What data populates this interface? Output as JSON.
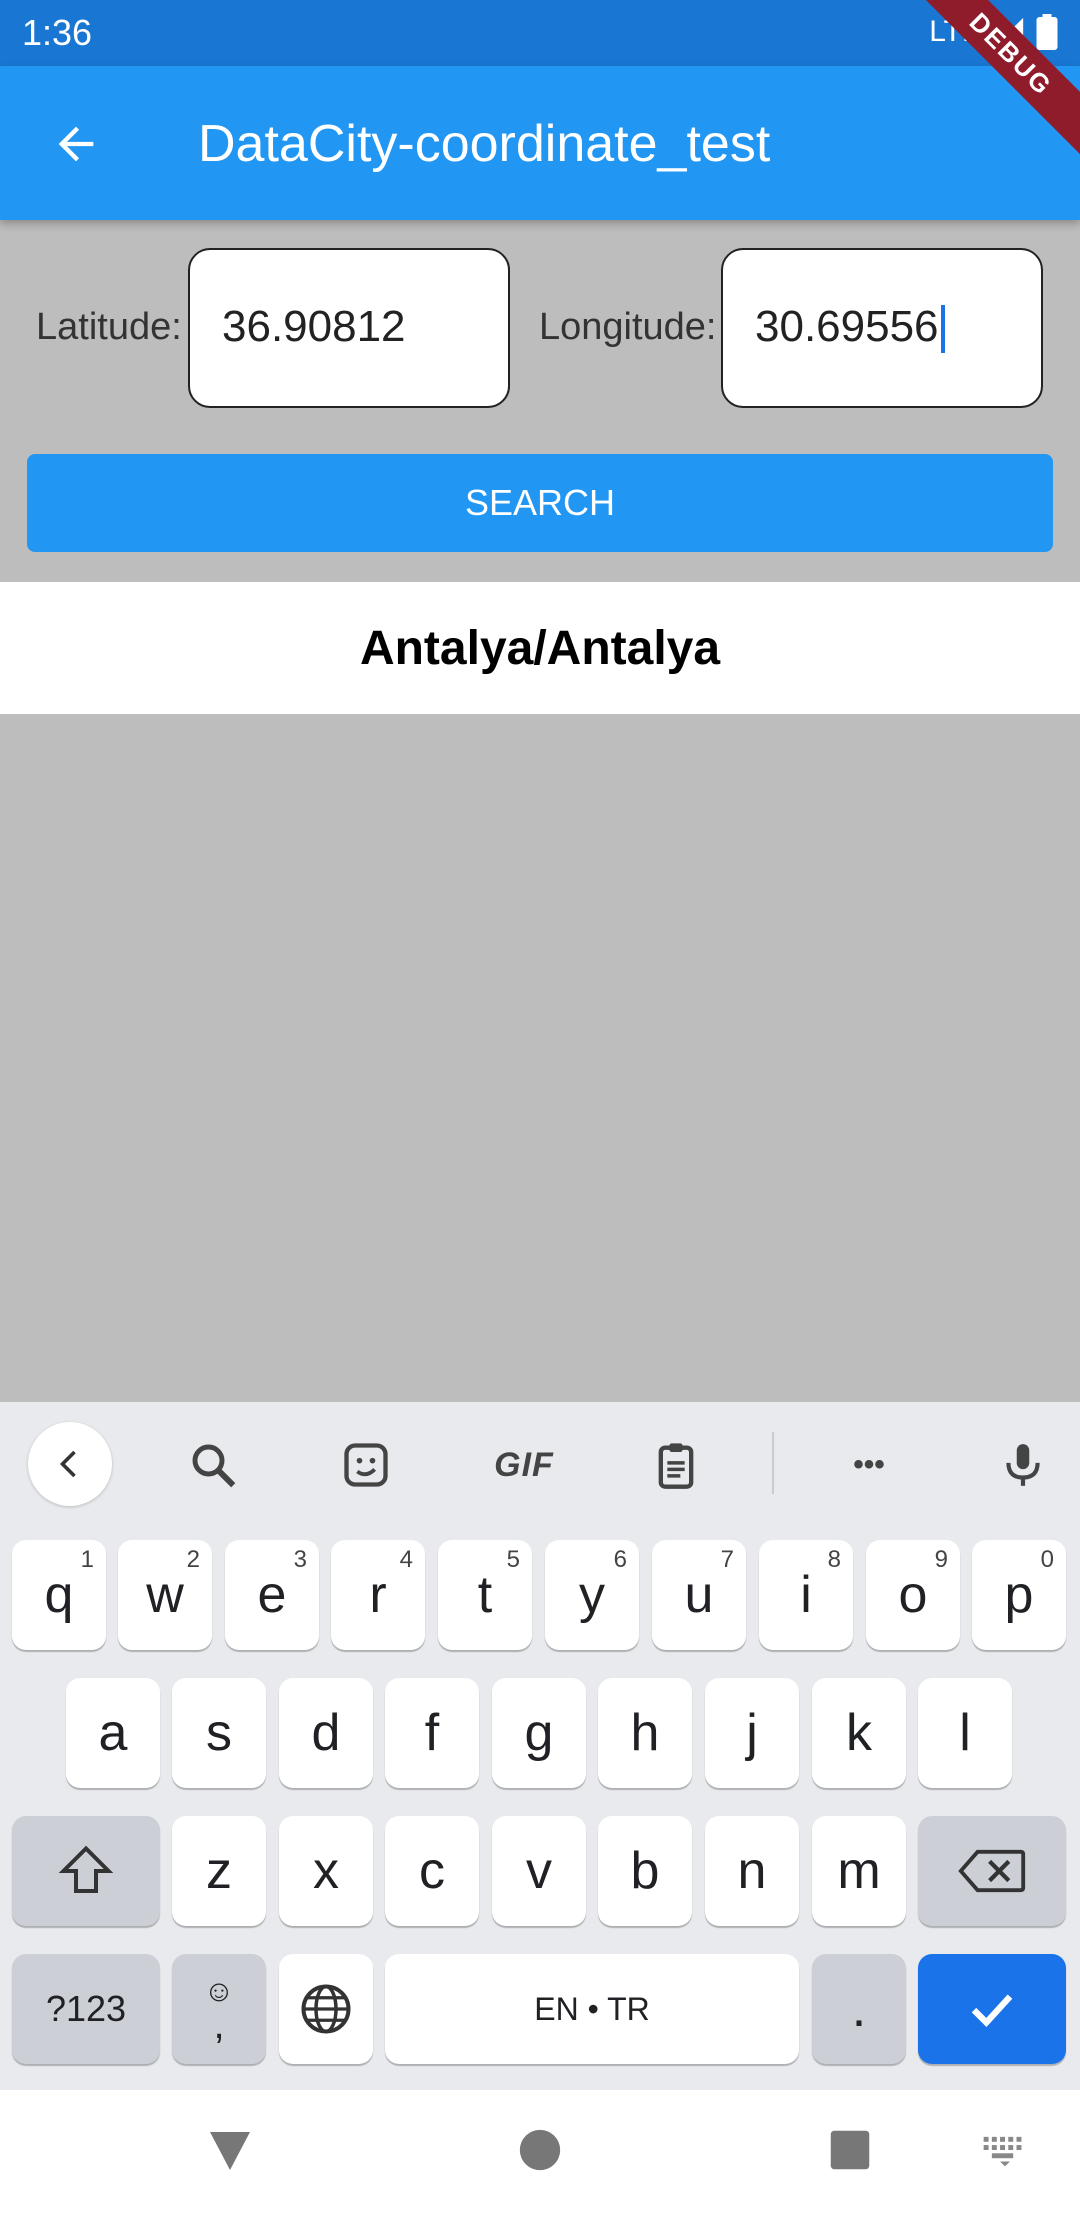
{
  "status_bar": {
    "time": "1:36",
    "network": "LTE"
  },
  "app_bar": {
    "title": "DataCity-coordinate_test",
    "debug_banner": "DEBUG"
  },
  "form": {
    "latitude_label": "Latitude:",
    "latitude_value": "36.90812",
    "longitude_label": "Longitude:",
    "longitude_value": "30.69556",
    "search_label": "SEARCH"
  },
  "result": {
    "text": "Antalya/Antalya"
  },
  "keyboard": {
    "toolbar": {
      "gif_label": "GIF",
      "more_label": "•••"
    },
    "row1": [
      {
        "k": "q",
        "sup": "1"
      },
      {
        "k": "w",
        "sup": "2"
      },
      {
        "k": "e",
        "sup": "3"
      },
      {
        "k": "r",
        "sup": "4"
      },
      {
        "k": "t",
        "sup": "5"
      },
      {
        "k": "y",
        "sup": "6"
      },
      {
        "k": "u",
        "sup": "7"
      },
      {
        "k": "i",
        "sup": "8"
      },
      {
        "k": "o",
        "sup": "9"
      },
      {
        "k": "p",
        "sup": "0"
      }
    ],
    "row2": [
      "a",
      "s",
      "d",
      "f",
      "g",
      "h",
      "j",
      "k",
      "l"
    ],
    "row3": [
      "z",
      "x",
      "c",
      "v",
      "b",
      "n",
      "m"
    ],
    "symbols_label": "?123",
    "emoji_label": "☺",
    "comma_label": ",",
    "space_label": "EN • TR",
    "period_label": "."
  }
}
